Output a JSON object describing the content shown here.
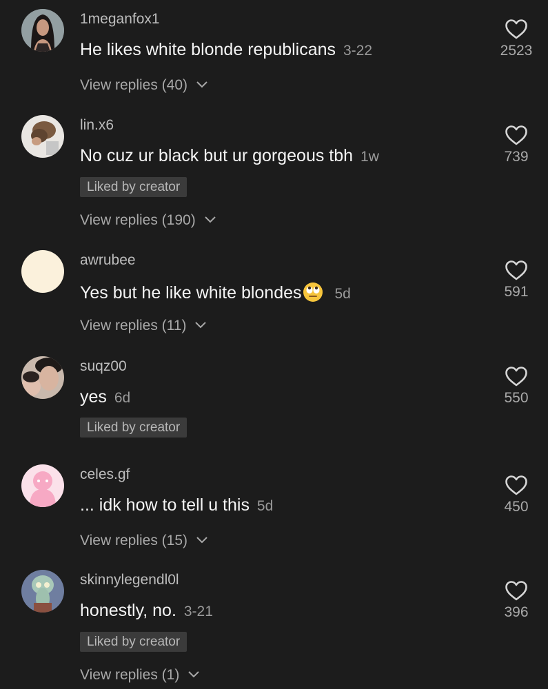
{
  "comments": [
    {
      "username": "1meganfox1",
      "text": "He likes white blonde republicans",
      "time": "3-22",
      "liked_by_creator": "",
      "replies": "View replies (40)",
      "likes": "2523",
      "avatar": "profile-photo"
    },
    {
      "username": "lin.x6",
      "text": "No cuz ur black but ur gorgeous tbh",
      "time": "1w",
      "liked_by_creator": "Liked by creator",
      "replies": "View replies (190)",
      "likes": "739",
      "avatar": "profile-photo"
    },
    {
      "username": "awrubee",
      "text": "Yes but he like white blondes",
      "time": "5d",
      "emoji": "face-with-rolling-eyes",
      "liked_by_creator": "",
      "replies": "View replies (11)",
      "likes": "591",
      "avatar": "plain-cream-circle"
    },
    {
      "username": "suqz00",
      "text": "yes",
      "time": "6d",
      "liked_by_creator": "Liked by creator",
      "replies": "",
      "likes": "550",
      "avatar": "profile-photo"
    },
    {
      "username": "celes.gf",
      "text": "... idk how to tell u this",
      "time": "5d",
      "liked_by_creator": "",
      "replies": "View replies (15)",
      "likes": "450",
      "avatar": "pink-cartoon"
    },
    {
      "username": "skinnylegendl0l",
      "text": "honestly, no.",
      "time": "3-21",
      "liked_by_creator": "Liked by creator",
      "replies": "View replies (1)",
      "likes": "396",
      "avatar": "cartoon-squidward"
    }
  ],
  "colors": {
    "background": "#1c1c1c",
    "text": "#f4f4f4",
    "muted": "#9a9a9a",
    "badge_bg": "#3b3b3b"
  },
  "icons": {
    "like": "heart-outline-icon",
    "expand": "chevron-down-icon"
  }
}
